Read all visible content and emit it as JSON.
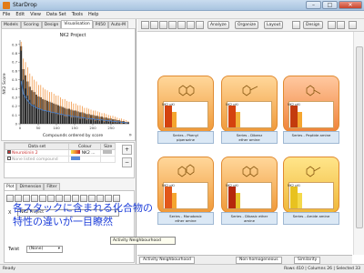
{
  "window": {
    "title": "StarDrop",
    "buttons": [
      "–",
      "□",
      "✕"
    ]
  },
  "menu": [
    "File",
    "Edit",
    "View",
    "Data Set",
    "Tools",
    "Help"
  ],
  "left_tabs": [
    {
      "label": "Models",
      "active": false
    },
    {
      "label": "Scoring",
      "active": false
    },
    {
      "label": "Design",
      "active": false
    },
    {
      "label": "Visualisation",
      "active": true
    },
    {
      "label": "P450",
      "active": false
    },
    {
      "label": "Auto-M",
      "active": false
    }
  ],
  "chart": {
    "title": "NK2 Project",
    "xlabel": "Compounds ordered by score",
    "ylabel": "NK2 Score",
    "xticks": [
      "0",
      "50",
      "100",
      "150",
      "200",
      "250"
    ],
    "yticks": [
      "0",
      "0.1",
      "0.2",
      "0.3",
      "0.4",
      "0.5",
      "0.6",
      "0.7",
      "0.8",
      "0.9"
    ],
    "chart_data": {
      "type": "bar",
      "ylim": [
        0,
        0.95
      ],
      "xlim": [
        0,
        300
      ],
      "values_sample": [
        0.88,
        0.62,
        0.55,
        0.48,
        0.42,
        0.38,
        0.36,
        0.33,
        0.31,
        0.3,
        0.28,
        0.27,
        0.26,
        0.25,
        0.24,
        0.23,
        0.22,
        0.21,
        0.2,
        0.19,
        0.18,
        0.17,
        0.17,
        0.16,
        0.15,
        0.15,
        0.14,
        0.13,
        0.13,
        0.12,
        0.11,
        0.11,
        0.1,
        0.1,
        0.09,
        0.09,
        0.08,
        0.08,
        0.07,
        0.07,
        0.06,
        0.06,
        0.05,
        0.05,
        0.04,
        0.04,
        0.03,
        0.03,
        0.02,
        0.02
      ],
      "error_sample": [
        0.05,
        0.12,
        0.15,
        0.16,
        0.15,
        0.16,
        0.14,
        0.15,
        0.13,
        0.14,
        0.13,
        0.12,
        0.12,
        0.11,
        0.12,
        0.11,
        0.1,
        0.11,
        0.1,
        0.09,
        0.1,
        0.09,
        0.08,
        0.09,
        0.08,
        0.08,
        0.07,
        0.08,
        0.07,
        0.06,
        0.07,
        0.06,
        0.06,
        0.05,
        0.06,
        0.05,
        0.05,
        0.04,
        0.05,
        0.04,
        0.04,
        0.03,
        0.04,
        0.03,
        0.03,
        0.02,
        0.03,
        0.02,
        0.02,
        0.01
      ],
      "bar_color": "#2a2a2a",
      "error_color": "#f08a2e",
      "highlight_color": "#3f7fd6"
    }
  },
  "dataset_table": {
    "headers": [
      "Data set",
      "Colour",
      "Size"
    ],
    "rows": [
      {
        "name": "Neurokinin 2",
        "colour_label": "NK2 ...",
        "checked": true
      },
      {
        "name": "None listed compound",
        "colour_label": "",
        "checked": false
      }
    ],
    "side_buttons": [
      "+",
      "−"
    ]
  },
  "lower_tabs": [
    {
      "label": "Plot",
      "active": true
    },
    {
      "label": "Dimension",
      "active": false
    },
    {
      "label": "Filter",
      "active": false
    }
  ],
  "lower_panel": {
    "x_label": "X",
    "x_value": "NK2 Project",
    "twist_label": "Twist",
    "twist_value": "(None)"
  },
  "right_toolbar": {
    "analyze": "Analyze",
    "organize": "Organize",
    "layout": "Layout",
    "design": "Design"
  },
  "cards": [
    {
      "caption": "Series - Phenyl\npiperazine",
      "badge": "NK2 pKi"
    },
    {
      "caption": "Series - Dibenz\nether amine",
      "badge": "NK2 pKi"
    },
    {
      "caption": "Series - Peptide amine",
      "badge": "NK2 pKi"
    },
    {
      "caption": "Series - Monobasic\nether amine",
      "badge": "NK2 pKi"
    },
    {
      "caption": "Series - Dibasic ether\namine",
      "badge": "NK2 pKi"
    },
    {
      "caption": "Series - Amide amine",
      "badge": "NK2 pKi"
    }
  ],
  "overlay_text": [
    "各スタックに含まれる化合物の",
    "特性の違いが一目瞭然"
  ],
  "bottom_tabs": [
    "Activity Neighbourhood",
    "Non-homogeneous",
    "Similarity"
  ],
  "tooltip": "Activity Neighbourhood",
  "status": {
    "left": "Ready",
    "right": "Rows 410 | Columns 26 | Selected 33"
  }
}
